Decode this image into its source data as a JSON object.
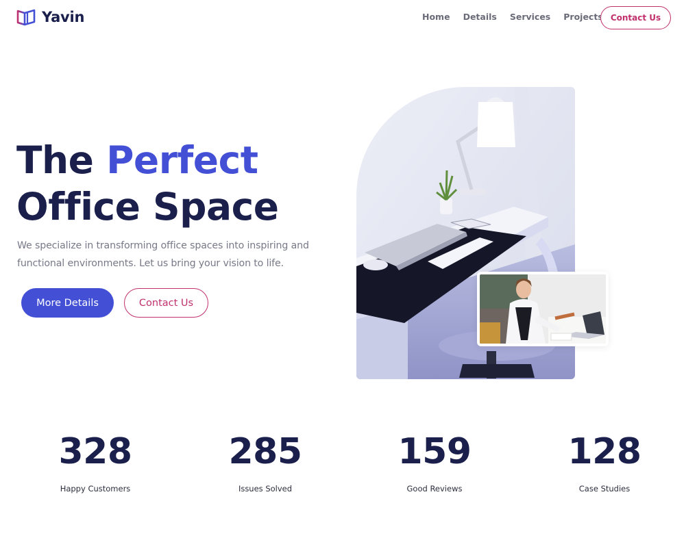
{
  "brand": {
    "name": "Yavin",
    "logo_icon": "book-icon",
    "colors": {
      "primary": "#4350d6",
      "secondary": "#c0306c",
      "dark": "#1b1f4b"
    }
  },
  "nav": {
    "items": [
      {
        "label": "Home"
      },
      {
        "label": "Details"
      },
      {
        "label": "Services"
      },
      {
        "label": "Projects"
      }
    ],
    "cta_label": "Contact Us"
  },
  "hero": {
    "title_part1": "The ",
    "title_accent": "Perfect",
    "title_line2": "Office Space",
    "description": "We specialize in transforming office spaces into inspiring and functional environments. Let us bring your vision to life.",
    "primary_button": "More Details",
    "secondary_button": "Contact Us"
  },
  "stats": [
    {
      "value": "328",
      "label": "Happy Customers"
    },
    {
      "value": "285",
      "label": "Issues Solved"
    },
    {
      "value": "159",
      "label": "Good Reviews"
    },
    {
      "value": "128",
      "label": "Case Studies"
    }
  ]
}
